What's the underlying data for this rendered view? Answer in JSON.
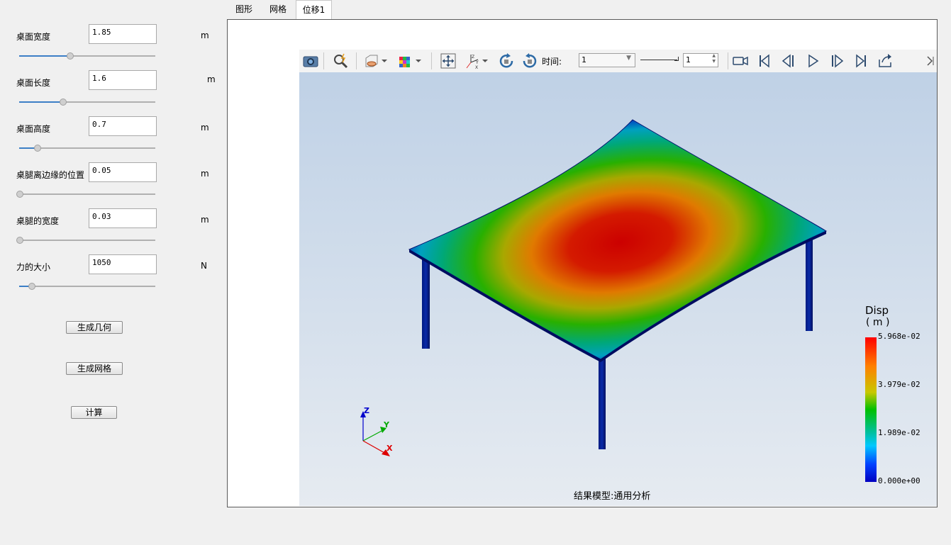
{
  "params": [
    {
      "label": "桌面宽度",
      "value": "1.85",
      "unit": "m",
      "slider": 0.37
    },
    {
      "label": "桌面长度",
      "value": "1.6",
      "unit": "m",
      "slider": 0.32
    },
    {
      "label": "桌面高度",
      "value": "0.7",
      "unit": "m",
      "slider": 0.13
    },
    {
      "label": "桌腿离边缘的位置",
      "value": "0.05",
      "unit": "m",
      "slider": 0.0
    },
    {
      "label": "桌腿的宽度",
      "value": "0.03",
      "unit": "m",
      "slider": 0.0
    },
    {
      "label": "力的大小",
      "value": "1050",
      "unit": "N",
      "slider": 0.09
    }
  ],
  "buttons": {
    "geometry": "生成几何",
    "mesh": "生成网格",
    "compute": "计算"
  },
  "tabs": [
    "图形",
    "网格",
    "位移1"
  ],
  "active_tab": 2,
  "toolbar": {
    "time_label": "时间:",
    "time_select": "1",
    "frame_spin": "1"
  },
  "legend": {
    "title": "Disp",
    "unit": "( m )",
    "max": "5.968e-02",
    "v2": "3.979e-02",
    "v1": "1.989e-02",
    "min": "0.000e+00"
  },
  "axes": {
    "z": "Z",
    "y": "Y",
    "x": "X"
  },
  "caption": "结果模型:通用分析",
  "colors": {
    "accent": "#3c7fc6",
    "bg": "#f0f0f0"
  }
}
